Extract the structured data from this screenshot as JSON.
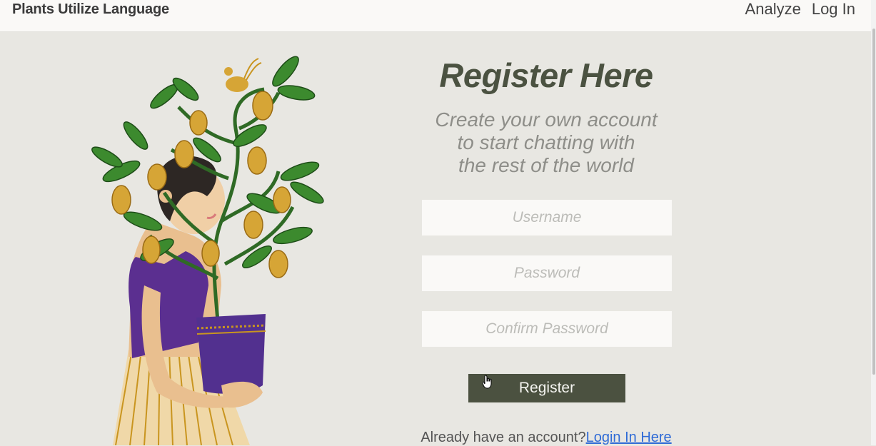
{
  "nav": {
    "brand": "Plants Utilize Language",
    "links": [
      {
        "label": "Analyze"
      },
      {
        "label": "Log In"
      }
    ]
  },
  "form": {
    "title": "Register Here",
    "subtitle_lines": [
      "Create your own account",
      "to start chatting with",
      "the rest of the world"
    ],
    "username_placeholder": "Username",
    "password_placeholder": "Password",
    "confirm_placeholder": "Confirm Password",
    "register_label": "Register",
    "login_prompt": "Already have an account?",
    "login_link": "Login In Here"
  },
  "colors": {
    "background": "#e8e7e2",
    "navbar": "#faf9f7",
    "accent": "#4b5140",
    "link": "#2f6bd6"
  },
  "illustration": {
    "icon": "woman-holding-plant-illustration"
  }
}
